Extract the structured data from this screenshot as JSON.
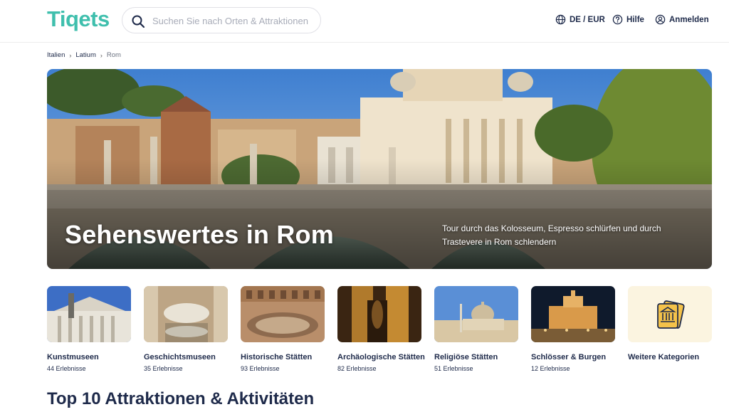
{
  "header": {
    "logo_text": "Tiqets",
    "search_placeholder": "Suchen Sie nach Orten & Attraktionen",
    "nav": {
      "language_currency": "DE / EUR",
      "help": "Hilfe",
      "login": "Anmelden"
    }
  },
  "breadcrumb": [
    "Italien",
    "Latium",
    "Rom"
  ],
  "hero": {
    "title": "Sehenswertes in Rom",
    "subtitle": "Tour durch das Kolosseum, Espresso schlürfen und durch Trastevere in Rom schlendern"
  },
  "categories": [
    {
      "name": "Kunstmuseen",
      "count": "44 Erlebnisse"
    },
    {
      "name": "Geschichtsmuseen",
      "count": "35 Erlebnisse"
    },
    {
      "name": "Historische Stätten",
      "count": "93 Erlebnisse"
    },
    {
      "name": "Archäologische Stätten",
      "count": "82 Erlebnisse"
    },
    {
      "name": "Religiöse Stätten",
      "count": "51 Erlebnisse"
    },
    {
      "name": "Schlösser & Burgen",
      "count": "12 Erlebnisse"
    },
    {
      "name": "Weitere Kategorien"
    }
  ],
  "section_title": "Top 10 Attraktionen & Aktivitäten",
  "colors": {
    "brand": "#3fbfad",
    "text_dark": "#1e2a4a",
    "more_categories_bg": "#fbf4e0",
    "more_categories_icon": "#f4c24a"
  }
}
